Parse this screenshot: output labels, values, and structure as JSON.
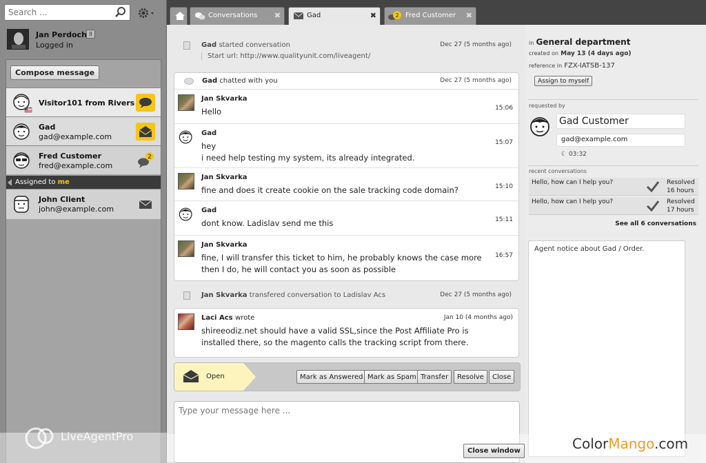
{
  "sidebar": {
    "search_placeholder": "Search ...",
    "user_name": "Jan Perdoch",
    "user_status": "Logged in",
    "pause_label": "II",
    "compose_label": "Compose message",
    "conversations": [
      {
        "name": "Visitor101 from Rivers",
        "email": ""
      },
      {
        "name": "Gad",
        "email": "gad@example.com"
      },
      {
        "name": "Fred Customer",
        "email": "fred@example.com",
        "badge": "2"
      }
    ],
    "assigned_prefix": "Assigned to",
    "assigned_me": "me",
    "assigned": [
      {
        "name": "John Client",
        "email": "john@example.com"
      }
    ],
    "watermark": "LiveAgentPro"
  },
  "tabs": {
    "conversations": "Conversations",
    "gad": "Gad",
    "fred": "Fred Customer",
    "fred_badge": "2",
    "close": "✖"
  },
  "center": {
    "started": {
      "who": "Gad",
      "text": "started conversation",
      "date": "Dec 27 (5 months ago)",
      "url": "Start url: http://www.qualityunit.com/liveagent/"
    },
    "chat_head": {
      "who": "Gad",
      "text": "chatted with you",
      "date": "Dec 27 (5 months ago)"
    },
    "messages": [
      {
        "name": "Jan Skvarka",
        "time": "15:06",
        "lines": [
          "Hello"
        ]
      },
      {
        "name": "Gad",
        "time": "15:07",
        "lines": [
          "hey",
          "i need help testing my system, its already integrated."
        ]
      },
      {
        "name": "Jan Skvarka",
        "time": "15:10",
        "lines": [
          "fine and does it create cookie on the sale tracking code domain?"
        ]
      },
      {
        "name": "Gad",
        "time": "15:11",
        "lines": [
          "dont know. Ladislav send me this"
        ]
      },
      {
        "name": "Jan Skvarka",
        "time": "16:57",
        "lines": [
          "fine, I will transfer this ticket to him, he probably knows the case more",
          "then I do, he will contact you as soon as possible"
        ]
      }
    ],
    "transfer": {
      "who": "Jan Skvarka",
      "text": "transfered conversation to Ladislav Acs",
      "date": "Dec 27 (5 months ago)"
    },
    "email": {
      "who": "Laci Acs",
      "text": "wrote",
      "date": "Jan 10 (4 months ago)",
      "lines": [
        "shireeodiz.net should have a valid SSL,since the Post Affiliate Pro is",
        "installed there, so the magento calls the tracking script from there."
      ]
    },
    "status": "Open",
    "actions": {
      "answered": "Mark as Answered",
      "spam": "Mark as Spam",
      "transfer": "Transfer",
      "resolve": "Resolve",
      "close": "Close"
    },
    "reply_placeholder": "Type your message here ...",
    "close_window": "Close window"
  },
  "right": {
    "in_label": "in",
    "department": "General department",
    "created_label": "created on",
    "created_value": "May 13 (4 days ago)",
    "reference_label": "reference in",
    "reference_value": "FZX-IATSB-137",
    "assign_label": "Assign to myself",
    "requested_label": "requested by",
    "customer_name": "Gad Customer",
    "customer_email": "gad@example.com",
    "customer_time": "03:32",
    "recent_label": "recent conversations",
    "recent": [
      {
        "text": "Hello, how can I help you?",
        "status": "Resolved",
        "ago": "16 hours"
      },
      {
        "text": "Hello, how can I help you?",
        "status": "Resolved",
        "ago": "17 hours"
      }
    ],
    "see_all": "See all 6 conversations",
    "notice": "Agent notice about  Gad  / Order.",
    "brand_a": "Color",
    "brand_b": "Mango",
    "brand_c": ".com"
  }
}
